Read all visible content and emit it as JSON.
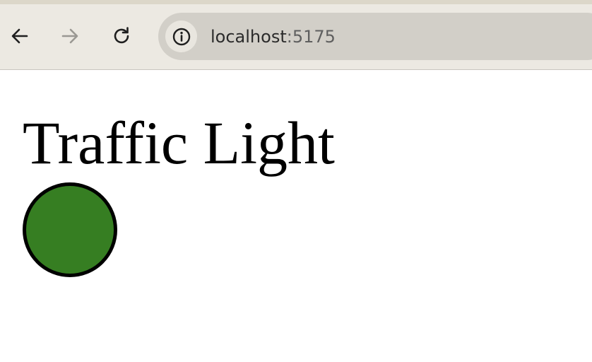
{
  "browser": {
    "url_host": "localhost",
    "url_port": ":5175",
    "icons": {
      "back": "arrow-left-icon",
      "forward": "arrow-right-icon",
      "reload": "reload-icon",
      "site_info": "info-icon"
    },
    "colors": {
      "chrome_bg": "#ece9e2",
      "address_bar_bg": "#d2cfc8",
      "forward_disabled": "#9a9893"
    }
  },
  "page": {
    "title": "Traffic Light",
    "light": {
      "state": "green",
      "color": "#367e22",
      "border_color": "#000000"
    }
  }
}
